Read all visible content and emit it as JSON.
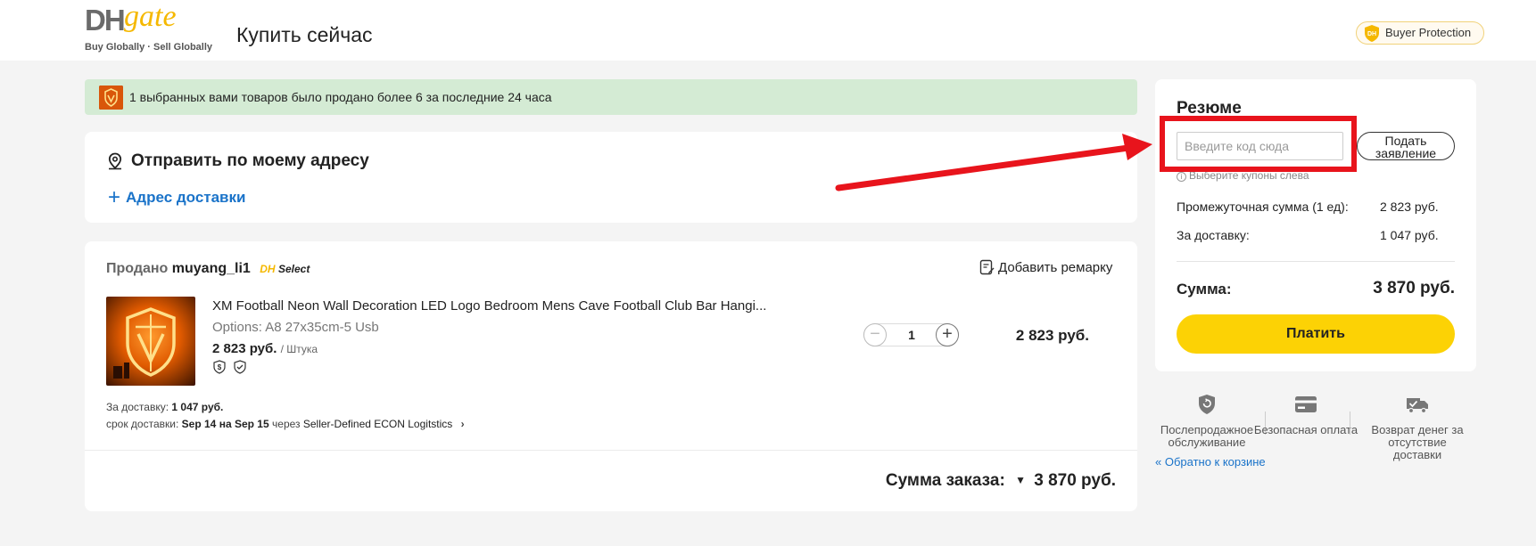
{
  "header": {
    "logo_dh": "DH",
    "logo_gate": "gate",
    "logo_tagline": "Buy Globally · Sell Globally",
    "page_title": "Купить сейчас",
    "buyer_protection": "Buyer Protection"
  },
  "notice": {
    "text": "1 выбранных вами товаров было продано более 6 за последние 24 часа"
  },
  "address": {
    "title": "Отправить по моему адресу",
    "add_link": "Адрес доставки"
  },
  "order": {
    "sold_by_label": "Продано",
    "seller_name": "muyang_li1",
    "select_badge_dh": "DH",
    "select_badge_text": "Select",
    "remark_label": "Добавить ремарку",
    "product": {
      "name": "XM Football Neon Wall Decoration LED Logo Bedroom Mens Cave Football Club Bar Hangi...",
      "options": "Options: A8 27x35cm-5 Usb",
      "price": "2 823 руб.",
      "unit": "/ Штука",
      "quantity": "1",
      "line_total": "2 823 руб."
    },
    "shipping_label": "За доставку:",
    "shipping_value": "1 047 руб.",
    "eta_label": "срок доставки:",
    "eta_from": "Sep 14",
    "eta_on": "на",
    "eta_to": "Sep 15",
    "eta_via": "через",
    "eta_carrier": "Seller-Defined ECON Logitstics",
    "total_label": "Сумма заказа:",
    "total_value": "3 870 руб."
  },
  "summary": {
    "title": "Резюме",
    "coupon_placeholder": "Введите код сюда",
    "apply_label": "Подать заявление",
    "coupon_hint": "Выберите купоны слева",
    "subtotal_label": "Промежуточная сумма (1 ед):",
    "subtotal_value": "2 823 руб.",
    "shipping_label": "За доставку:",
    "shipping_value": "1 047 руб.",
    "total_label": "Сумма:",
    "total_value": "3 870 руб.",
    "pay_label": "Платить"
  },
  "guarantees": [
    {
      "label": "Послепродажное обслуживание",
      "icon": "after-sales-icon"
    },
    {
      "label": "Безопасная оплата",
      "icon": "card-icon"
    },
    {
      "label": "Возврат денег за отсутствие доставки",
      "icon": "truck-check-icon"
    }
  ],
  "back_link": "« Обратно к корзине",
  "colors": {
    "accent_yellow": "#fcd205",
    "link_blue": "#1a73c9",
    "notice_green": "#d4ebd4",
    "annotation_red": "#e8141c"
  }
}
